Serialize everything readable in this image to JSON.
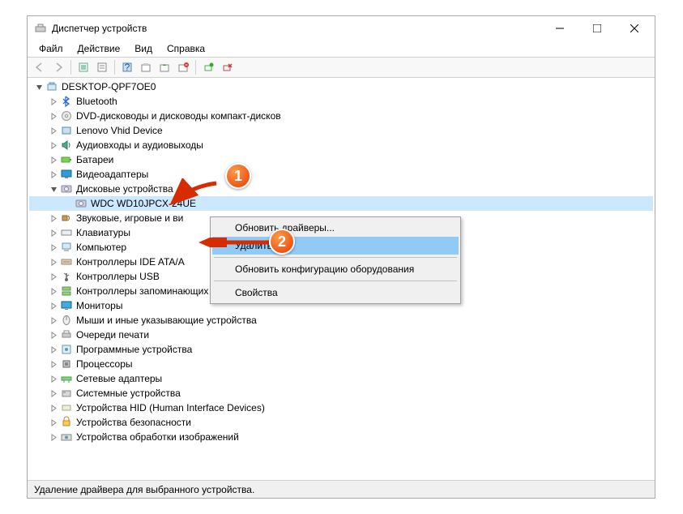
{
  "window": {
    "title": "Диспетчер устройств"
  },
  "menubar": {
    "file": "Файл",
    "action": "Действие",
    "view": "Вид",
    "help": "Справка"
  },
  "tree": {
    "root": "DESKTOP-QPF7OE0",
    "items": [
      {
        "label": "Bluetooth",
        "icon": "bluetooth"
      },
      {
        "label": "DVD-дисководы и дисководы компакт-дисков",
        "icon": "disc"
      },
      {
        "label": "Lenovo Vhid Device",
        "icon": "device"
      },
      {
        "label": "Аудиовходы и аудиовыходы",
        "icon": "audio"
      },
      {
        "label": "Батареи",
        "icon": "battery"
      },
      {
        "label": "Видеоадаптеры",
        "icon": "display"
      },
      {
        "label": "Дисковые устройства",
        "icon": "disk",
        "expanded": true,
        "children": [
          {
            "label": "WDC WD10JPCX-24UE",
            "icon": "disk",
            "selected": true
          }
        ]
      },
      {
        "label": "Звуковые, игровые и ви",
        "icon": "sound"
      },
      {
        "label": "Клавиатуры",
        "icon": "keyboard"
      },
      {
        "label": "Компьютер",
        "icon": "computer"
      },
      {
        "label": "Контроллеры IDE ATA/A",
        "icon": "ide"
      },
      {
        "label": "Контроллеры USB",
        "icon": "usb"
      },
      {
        "label": "Контроллеры запоминающих устройств",
        "icon": "storage"
      },
      {
        "label": "Мониторы",
        "icon": "monitor"
      },
      {
        "label": "Мыши и иные указывающие устройства",
        "icon": "mouse"
      },
      {
        "label": "Очереди печати",
        "icon": "printer"
      },
      {
        "label": "Программные устройства",
        "icon": "software"
      },
      {
        "label": "Процессоры",
        "icon": "cpu"
      },
      {
        "label": "Сетевые адаптеры",
        "icon": "network"
      },
      {
        "label": "Системные устройства",
        "icon": "system"
      },
      {
        "label": "Устройства HID (Human Interface Devices)",
        "icon": "hid"
      },
      {
        "label": "Устройства безопасности",
        "icon": "security"
      },
      {
        "label": "Устройства обработки изображений",
        "icon": "imaging"
      }
    ]
  },
  "context_menu": {
    "update_drivers": "Обновить драйверы...",
    "uninstall": "Удалить",
    "scan_hardware": "Обновить конфигурацию оборудования",
    "properties": "Свойства",
    "highlighted": "uninstall"
  },
  "callouts": {
    "c1": "1",
    "c2": "2"
  },
  "statusbar": {
    "text": "Удаление драйвера для выбранного устройства."
  }
}
